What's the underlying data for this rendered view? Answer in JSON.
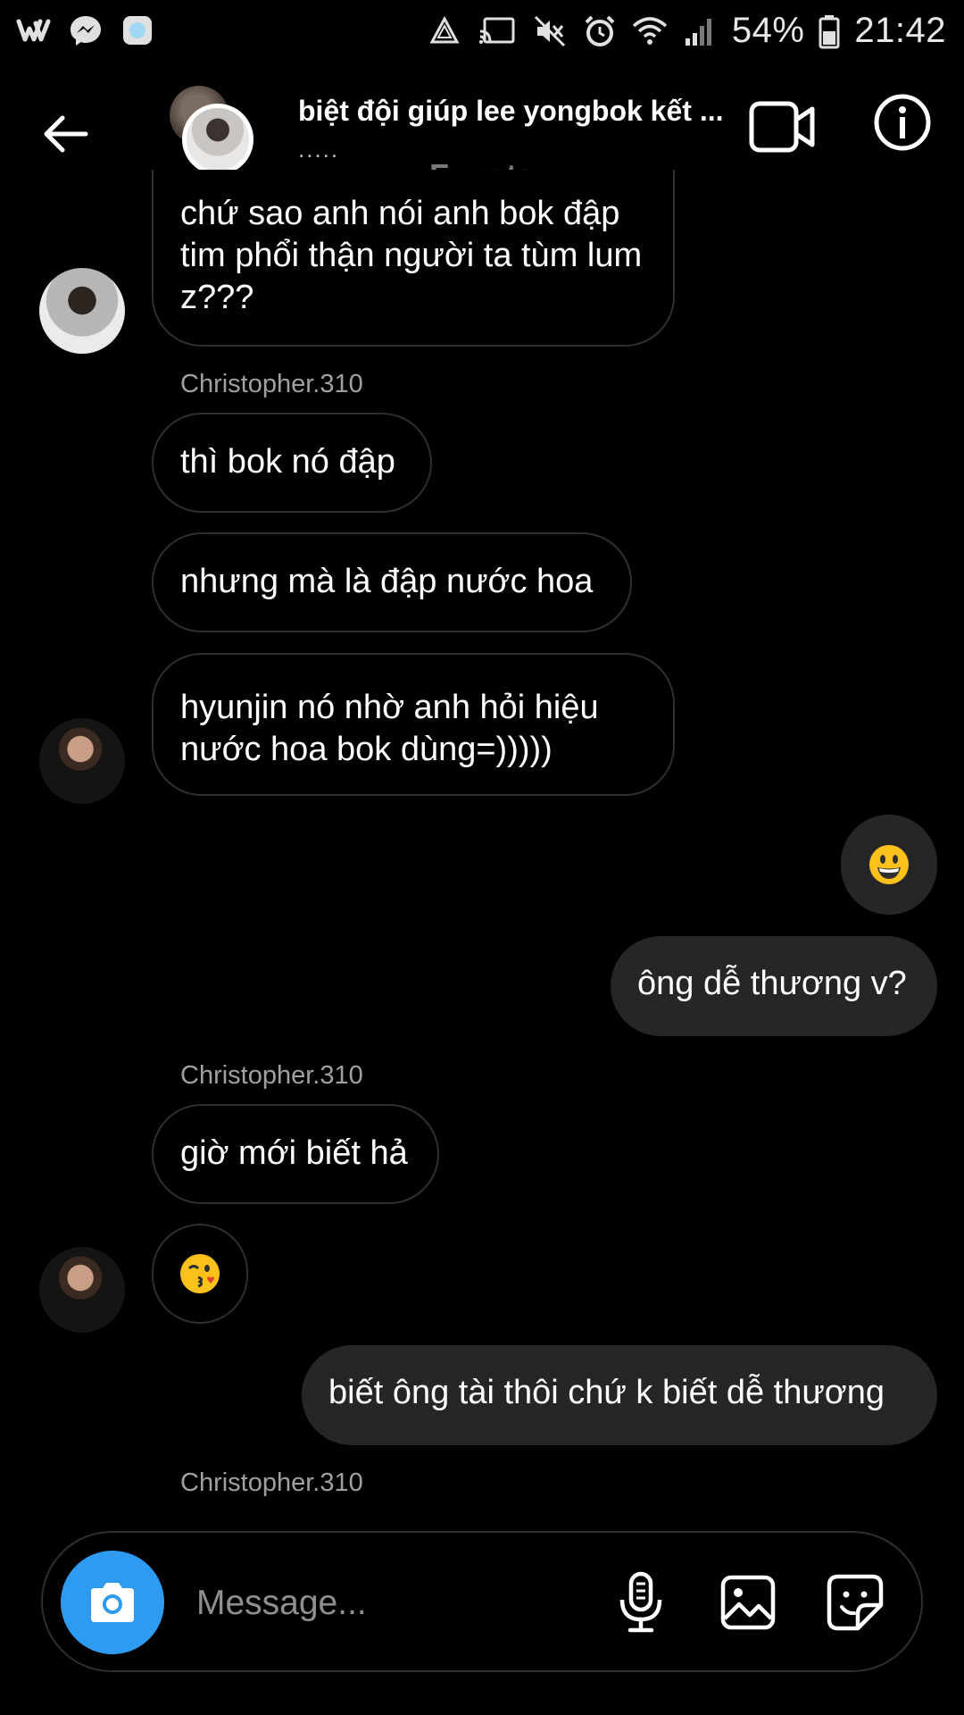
{
  "status_bar": {
    "battery_percent": "54%",
    "time": "21:42",
    "left_icons": [
      "wattpad-icon",
      "messenger-icon",
      "app-icon"
    ],
    "right_icons": [
      "recycle-icon",
      "cast-icon",
      "mute-icon",
      "alarm-icon",
      "wifi-icon",
      "signal-icon",
      "battery-icon"
    ]
  },
  "header": {
    "title": "biệt đội giúp lee yongbok kết ...",
    "subtitle": ".....",
    "account_label": "Funsta"
  },
  "messages": [
    {
      "id": "m1",
      "side": "in",
      "text": "chứ sao anh nói anh bok đập tim phổi thận người ta tùm lum z???"
    },
    {
      "id": "s1",
      "type": "sender",
      "text": "Christopher.310"
    },
    {
      "id": "m2",
      "side": "in",
      "text": "thì bok nó đập"
    },
    {
      "id": "m3",
      "side": "in",
      "text": "nhưng mà là đập nước hoa"
    },
    {
      "id": "m4",
      "side": "in",
      "text": "hyunjin nó nhờ anh hỏi hiệu nước hoa bok dùng=)))))"
    },
    {
      "id": "m5",
      "side": "out",
      "emoji": "grinning-face-emoji"
    },
    {
      "id": "m6",
      "side": "out",
      "text": "ông dễ thương v?"
    },
    {
      "id": "s2",
      "type": "sender",
      "text": "Christopher.310"
    },
    {
      "id": "m7",
      "side": "in",
      "text": "giờ mới biết hả"
    },
    {
      "id": "m8",
      "side": "in",
      "emoji": "kissing-face-winking-emoji"
    },
    {
      "id": "m9",
      "side": "out",
      "text": "biết ông tài thôi chứ k biết dễ thương"
    },
    {
      "id": "s3",
      "type": "sender",
      "text": "Christopher.310"
    }
  ],
  "composer": {
    "placeholder": "Message...",
    "buttons": [
      "camera-icon",
      "microphone-icon",
      "gallery-icon",
      "sticker-icon"
    ]
  },
  "colors": {
    "background": "#000000",
    "outgoing_bubble": "#262626",
    "incoming_border": "#2f2f2f",
    "camera_button": "#2f9bf0",
    "sender_text": "#a0a0a0"
  }
}
